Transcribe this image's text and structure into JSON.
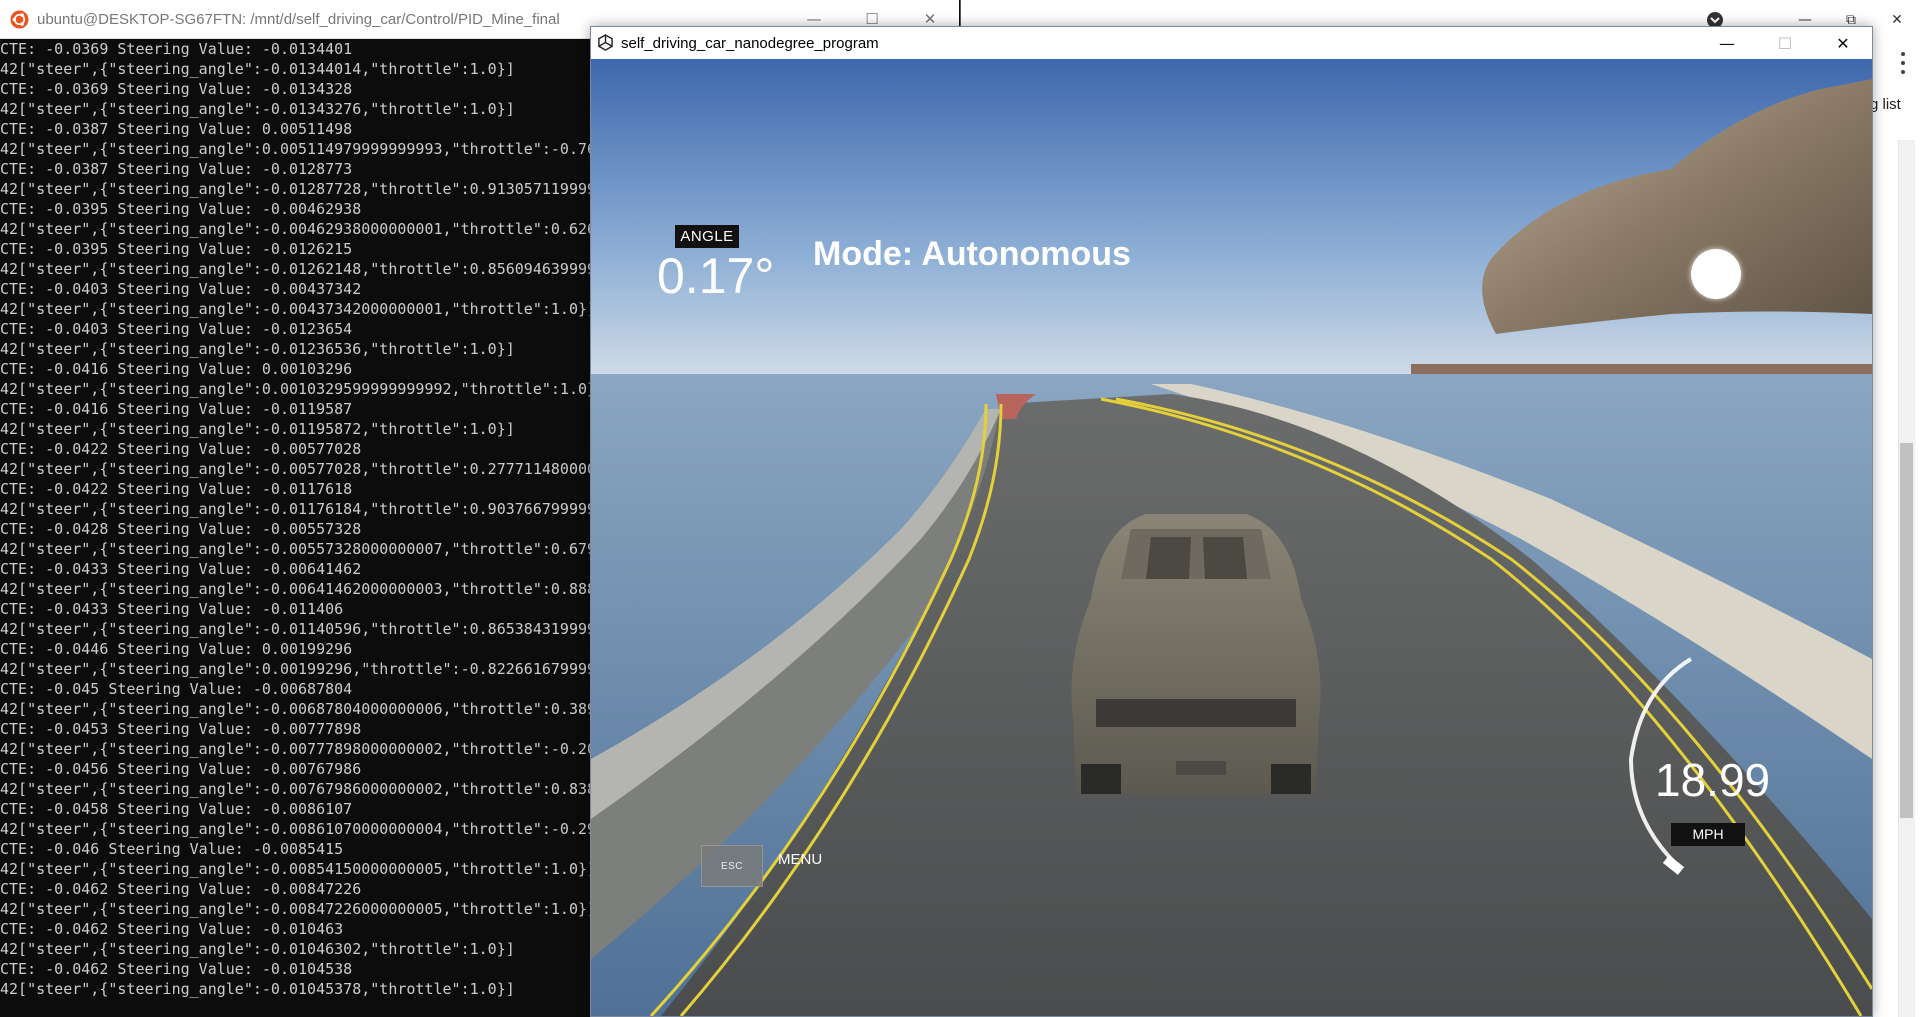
{
  "background_window": {
    "partial_text": "g list"
  },
  "terminal": {
    "title": "ubuntu@DESKTOP-SG67FTN: /mnt/d/self_driving_car/Control/PID_Mine_final",
    "lines": [
      "CTE: -0.0369 Steering Value: -0.0134401",
      "42[\"steer\",{\"steering_angle\":-0.01344014,\"throttle\":1.0}]",
      "CTE: -0.0369 Steering Value: -0.0134328",
      "42[\"steer\",{\"steering_angle\":-0.01343276,\"throttle\":1.0}]",
      "CTE: -0.0387 Steering Value: 0.00511498",
      "42[\"steer\",{\"steering_angle\":0.005114979999999993,\"throttle\":-0.768",
      "CTE: -0.0387 Steering Value: -0.0128773",
      "42[\"steer\",{\"steering_angle\":-0.01287728,\"throttle\":0.913057119999",
      "CTE: -0.0395 Steering Value: -0.00462938",
      "42[\"steer\",{\"steering_angle\":-0.00462938000000001,\"throttle\":0.626",
      "CTE: -0.0395 Steering Value: -0.0126215",
      "42[\"steer\",{\"steering_angle\":-0.01262148,\"throttle\":0.856094639999",
      "CTE: -0.0403 Steering Value: -0.00437342",
      "42[\"steer\",{\"steering_angle\":-0.00437342000000001,\"throttle\":1.0}]",
      "CTE: -0.0403 Steering Value: -0.0123654",
      "42[\"steer\",{\"steering_angle\":-0.01236536,\"throttle\":1.0}]",
      "CTE: -0.0416 Steering Value: 0.00103296",
      "42[\"steer\",{\"steering_angle\":0.0010329599999999992,\"throttle\":1.0}]",
      "CTE: -0.0416 Steering Value: -0.0119587",
      "42[\"steer\",{\"steering_angle\":-0.01195872,\"throttle\":1.0}]",
      "CTE: -0.0422 Steering Value: -0.00577028",
      "42[\"steer\",{\"steering_angle\":-0.00577028,\"throttle\":0.277711480000",
      "CTE: -0.0422 Steering Value: -0.0117618",
      "42[\"steer\",{\"steering_angle\":-0.01176184,\"throttle\":0.903766799999",
      "CTE: -0.0428 Steering Value: -0.00557328",
      "42[\"steer\",{\"steering_angle\":-0.00557328000000007,\"throttle\":0.679",
      "CTE: -0.0433 Steering Value: -0.00641462",
      "42[\"steer\",{\"steering_angle\":-0.00641462000000003,\"throttle\":0.888",
      "CTE: -0.0433 Steering Value: -0.011406",
      "42[\"steer\",{\"steering_angle\":-0.01140596,\"throttle\":0.865384319999",
      "CTE: -0.0446 Steering Value: 0.00199296",
      "42[\"steer\",{\"steering_angle\":0.00199296,\"throttle\":-0.822661679999",
      "CTE: -0.045 Steering Value: -0.00687804",
      "42[\"steer\",{\"steering_angle\":-0.00687804000000006,\"throttle\":0.389",
      "CTE: -0.0453 Steering Value: -0.00777898",
      "42[\"steer\",{\"steering_angle\":-0.00777898000000002,\"throttle\":-0.20",
      "CTE: -0.0456 Steering Value: -0.00767986",
      "42[\"steer\",{\"steering_angle\":-0.00767986000000002,\"throttle\":0.838",
      "CTE: -0.0458 Steering Value: -0.0086107",
      "42[\"steer\",{\"steering_angle\":-0.00861070000000004,\"throttle\":-0.29",
      "CTE: -0.046 Steering Value: -0.0085415",
      "42[\"steer\",{\"steering_angle\":-0.00854150000000005,\"throttle\":1.0}]",
      "CTE: -0.0462 Steering Value: -0.00847226",
      "42[\"steer\",{\"steering_angle\":-0.00847226000000005,\"throttle\":1.0}]",
      "CTE: -0.0462 Steering Value: -0.010463",
      "42[\"steer\",{\"steering_angle\":-0.01046302,\"throttle\":1.0}]",
      "CTE: -0.0462 Steering Value: -0.0104538",
      "42[\"steer\",{\"steering_angle\":-0.01045378,\"throttle\":1.0}]"
    ]
  },
  "simulator": {
    "title": "self_driving_car_nanodegree_program",
    "hud": {
      "angle_label": "ANGLE",
      "angle_value": "0.17°",
      "mode": "Mode: Autonomous",
      "esc_label": "ESC",
      "menu_label": "MENU",
      "speed_value": "18.99",
      "speed_unit": "MPH"
    }
  },
  "colors": {
    "terminal_bg": "#0c0c0c",
    "terminal_text": "#cccccc",
    "sky_top": "#4f76b4",
    "sky_bottom": "#c9d6e6",
    "water": "#6f8fb0",
    "road": "#5a5c5e",
    "lane_line": "#e8d43a",
    "hud_tag_bg": "#111111"
  },
  "icons": {
    "terminal_logo": "ubuntu-logo-icon",
    "simulator_logo": "unity-logo-icon",
    "minimize": "minimize-icon",
    "maximize": "maximize-icon",
    "close": "close-icon"
  }
}
